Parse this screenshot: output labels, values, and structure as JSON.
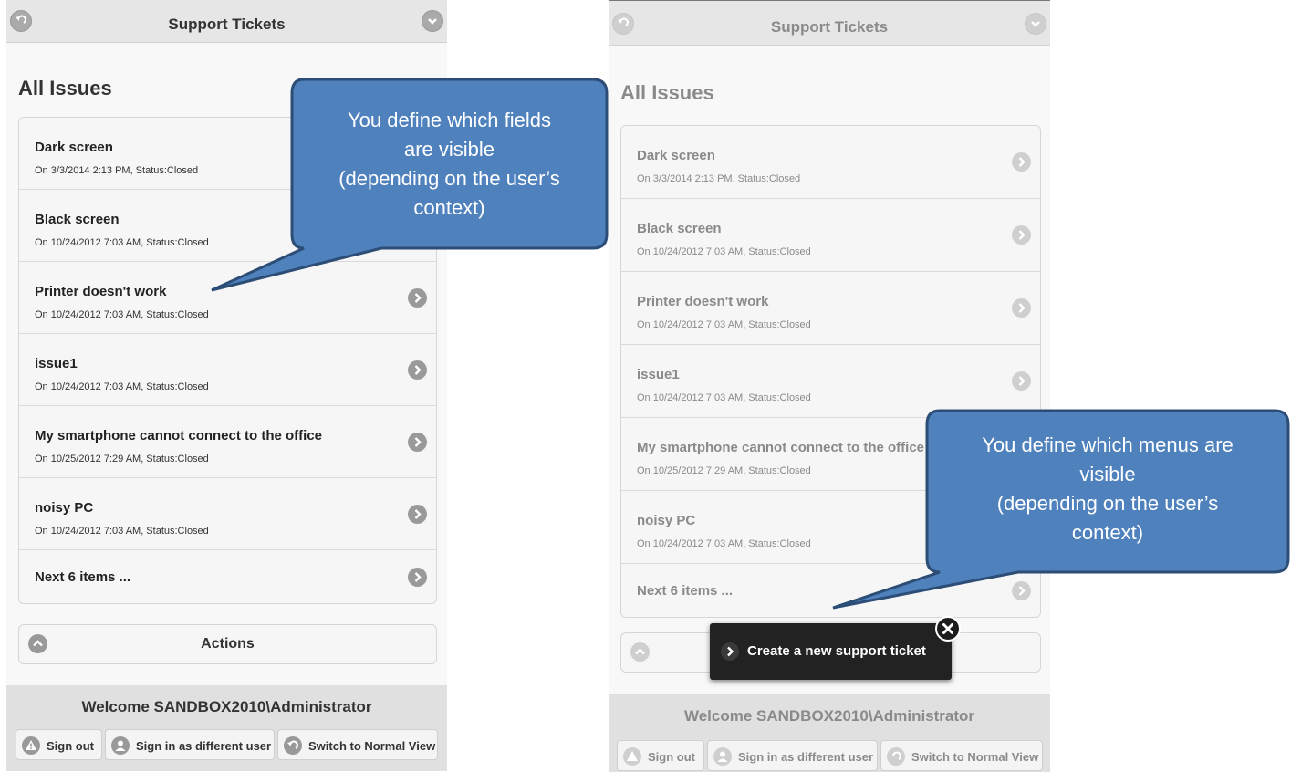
{
  "left": {
    "header": {
      "title": "Support Tickets"
    },
    "page_title": "All Issues",
    "items": [
      {
        "title": "Dark screen",
        "subtitle": "On 3/3/2014 2:13 PM, Status:Closed"
      },
      {
        "title": "Black screen",
        "subtitle": "On 10/24/2012 7:03 AM, Status:Closed"
      },
      {
        "title": "Printer doesn't work",
        "subtitle": "On 10/24/2012 7:03 AM, Status:Closed"
      },
      {
        "title": "issue1",
        "subtitle": "On 10/24/2012 7:03 AM, Status:Closed"
      },
      {
        "title": "My smartphone cannot connect to the office",
        "subtitle": "On 10/25/2012 7:29 AM, Status:Closed"
      },
      {
        "title": "noisy PC",
        "subtitle": "On 10/24/2012 7:03 AM, Status:Closed"
      }
    ],
    "next_label": "Next 6 items ...",
    "actions_label": "Actions",
    "footer": {
      "welcome": "Welcome SANDBOX2010\\Administrator",
      "sign_out": "Sign out",
      "sign_in_different": "Sign in as different user",
      "switch_view": "Switch to Normal View"
    }
  },
  "right": {
    "header": {
      "title": "Support Tickets"
    },
    "page_title": "All Issues",
    "items": [
      {
        "title": "Dark screen",
        "subtitle": "On 3/3/2014 2:13 PM, Status:Closed"
      },
      {
        "title": "Black screen",
        "subtitle": "On 10/24/2012 7:03 AM, Status:Closed"
      },
      {
        "title": "Printer doesn't work",
        "subtitle": "On 10/24/2012 7:03 AM, Status:Closed"
      },
      {
        "title": "issue1",
        "subtitle": "On 10/24/2012 7:03 AM, Status:Closed"
      },
      {
        "title": "My smartphone cannot connect to the office",
        "subtitle": "On 10/25/2012 7:29 AM, Status:Closed"
      },
      {
        "title": "noisy PC",
        "subtitle": "On 10/24/2012 7:03 AM, Status:Closed"
      }
    ],
    "next_label": "Next 6 items ...",
    "popup_menu_item": "Create a new support ticket",
    "footer": {
      "welcome": "Welcome SANDBOX2010\\Administrator",
      "sign_out": "Sign out",
      "sign_in_different": "Sign in as different user",
      "switch_view": "Switch to Normal View"
    }
  },
  "callouts": {
    "fields": [
      "You define which fields",
      "are visible",
      "(depending on the user’s",
      "context)"
    ],
    "menus": [
      "You define which menus are",
      "visible",
      "(depending on the user’s",
      "context)"
    ]
  },
  "colors": {
    "callout_fill": "#4f81bd",
    "callout_border": "#2c4d75",
    "popup_bg": "#222222"
  },
  "icons": {
    "header_left": "back-circle-icon",
    "header_right": "chevron-down-circle-icon",
    "list_arrow": "chevron-right-circle-icon",
    "actions": "chevron-up-circle-icon",
    "sign_out": "alert-icon",
    "sign_in_different": "user-icon",
    "switch_view": "back-circle-icon",
    "popup_close": "close-icon"
  }
}
